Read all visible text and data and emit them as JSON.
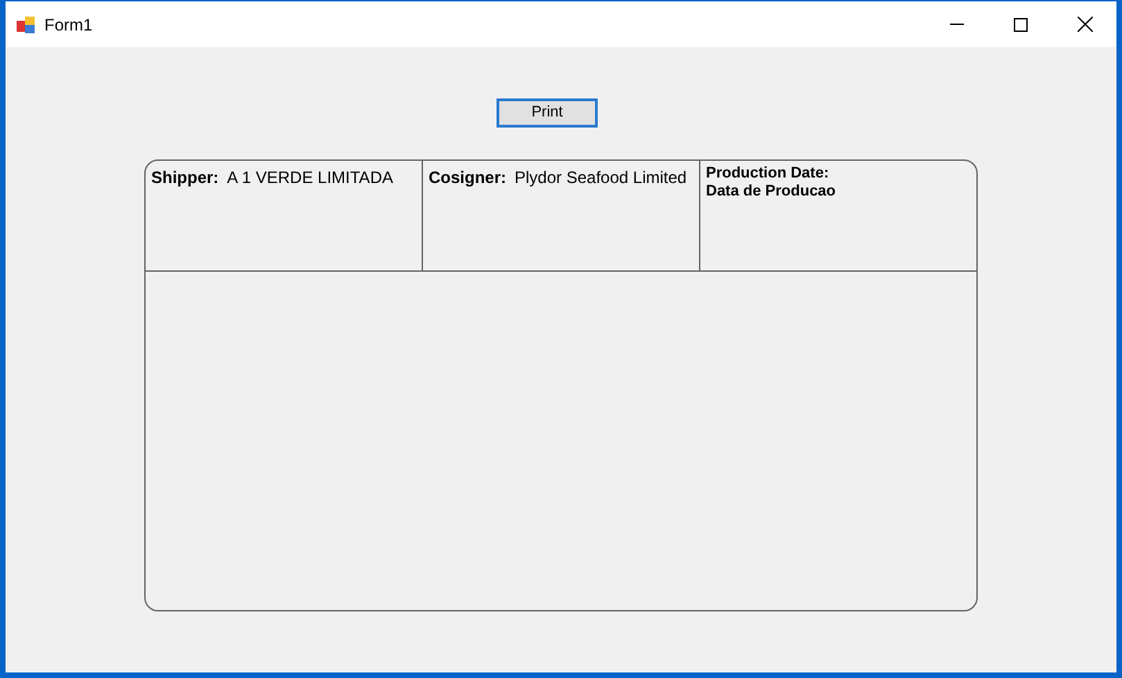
{
  "window": {
    "title": "Form1"
  },
  "print_button": {
    "label": "Print"
  },
  "cells": [
    {
      "kind": "inline",
      "label": "Shipper:",
      "value": "A 1 VERDE LIMITADA"
    },
    {
      "kind": "inline",
      "label": "Cosigner:",
      "value": "Plydor Seafood Limited"
    },
    {
      "kind": "stacked",
      "label": "Production Date:",
      "value": "Data de Producao"
    }
  ]
}
